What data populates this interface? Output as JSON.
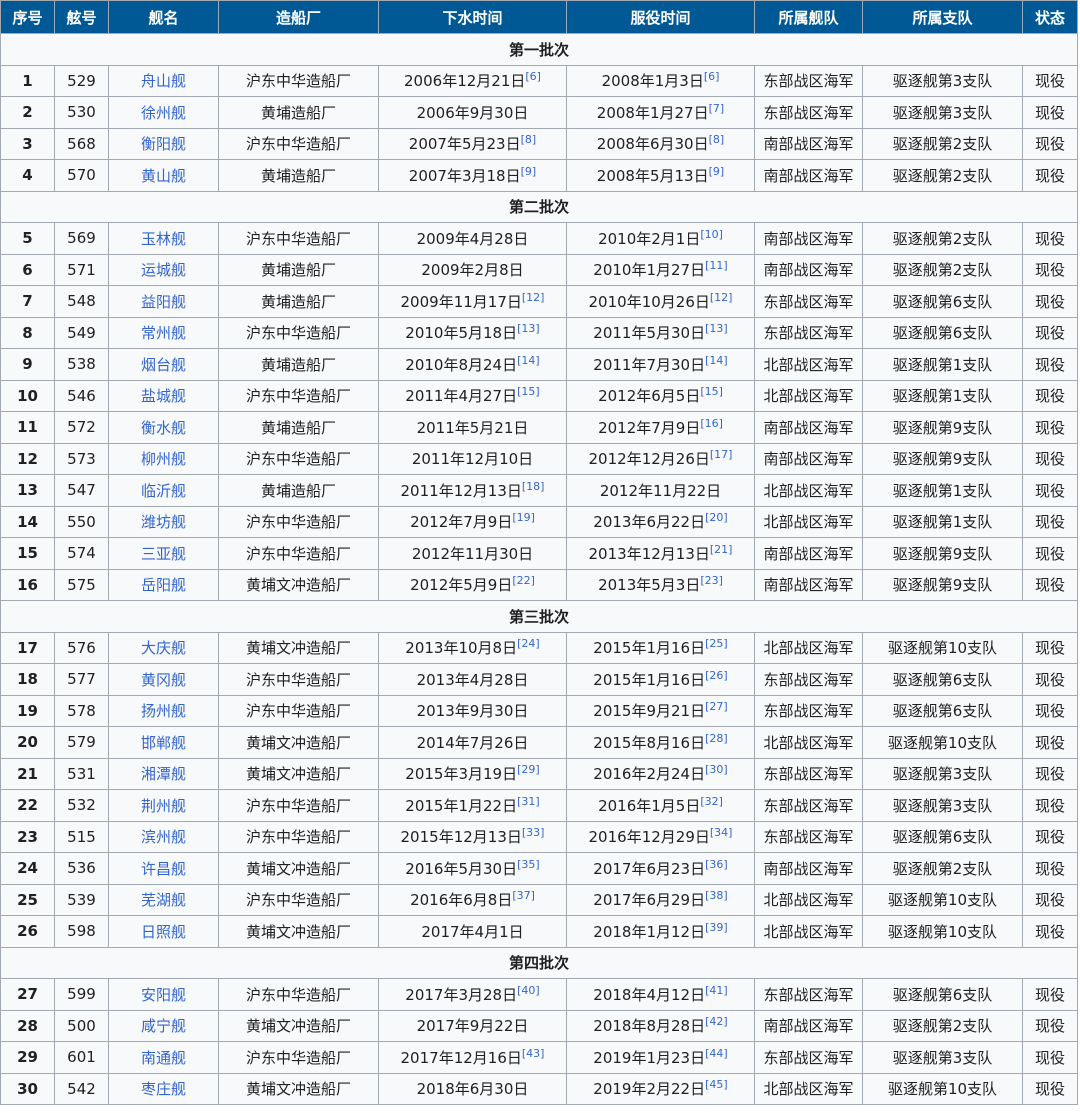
{
  "headers": [
    "序号",
    "舷号",
    "舰名",
    "造船厂",
    "下水时间",
    "服役时间",
    "所属舰队",
    "所属支队",
    "状态"
  ],
  "groups": [
    {
      "title": "第一批次",
      "rows": [
        {
          "no": "1",
          "hull": "529",
          "name": "舟山舰",
          "yard": "沪东中华造船厂",
          "launch": "2006年12月21日",
          "launch_ref": "[6]",
          "commission": "2008年1月3日",
          "commission_ref": "[6]",
          "fleet": "东部战区海军",
          "flotilla": "驱逐舰第3支队",
          "status": "现役"
        },
        {
          "no": "2",
          "hull": "530",
          "name": "徐州舰",
          "yard": "黄埔造船厂",
          "launch": "2006年9月30日",
          "launch_ref": "",
          "commission": "2008年1月27日",
          "commission_ref": "[7]",
          "fleet": "东部战区海军",
          "flotilla": "驱逐舰第3支队",
          "status": "现役"
        },
        {
          "no": "3",
          "hull": "568",
          "name": "衡阳舰",
          "yard": "沪东中华造船厂",
          "launch": "2007年5月23日",
          "launch_ref": "[8]",
          "commission": "2008年6月30日",
          "commission_ref": "[8]",
          "fleet": "南部战区海军",
          "flotilla": "驱逐舰第2支队",
          "status": "现役"
        },
        {
          "no": "4",
          "hull": "570",
          "name": "黄山舰",
          "yard": "黄埔造船厂",
          "launch": "2007年3月18日",
          "launch_ref": "[9]",
          "commission": "2008年5月13日",
          "commission_ref": "[9]",
          "fleet": "南部战区海军",
          "flotilla": "驱逐舰第2支队",
          "status": "现役"
        }
      ]
    },
    {
      "title": "第二批次",
      "rows": [
        {
          "no": "5",
          "hull": "569",
          "name": "玉林舰",
          "yard": "沪东中华造船厂",
          "launch": "2009年4月28日",
          "launch_ref": "",
          "commission": "2010年2月1日",
          "commission_ref": "[10]",
          "fleet": "南部战区海军",
          "flotilla": "驱逐舰第2支队",
          "status": "现役"
        },
        {
          "no": "6",
          "hull": "571",
          "name": "运城舰",
          "yard": "黄埔造船厂",
          "launch": "2009年2月8日",
          "launch_ref": "",
          "commission": "2010年1月27日",
          "commission_ref": "[11]",
          "fleet": "南部战区海军",
          "flotilla": "驱逐舰第2支队",
          "status": "现役"
        },
        {
          "no": "7",
          "hull": "548",
          "name": "益阳舰",
          "yard": "黄埔造船厂",
          "launch": "2009年11月17日",
          "launch_ref": "[12]",
          "commission": "2010年10月26日",
          "commission_ref": "[12]",
          "fleet": "东部战区海军",
          "flotilla": "驱逐舰第6支队",
          "status": "现役"
        },
        {
          "no": "8",
          "hull": "549",
          "name": "常州舰",
          "yard": "沪东中华造船厂",
          "launch": "2010年5月18日",
          "launch_ref": "[13]",
          "commission": "2011年5月30日",
          "commission_ref": "[13]",
          "fleet": "东部战区海军",
          "flotilla": "驱逐舰第6支队",
          "status": "现役"
        },
        {
          "no": "9",
          "hull": "538",
          "name": "烟台舰",
          "yard": "黄埔造船厂",
          "launch": "2010年8月24日",
          "launch_ref": "[14]",
          "commission": "2011年7月30日",
          "commission_ref": "[14]",
          "fleet": "北部战区海军",
          "flotilla": "驱逐舰第1支队",
          "status": "现役"
        },
        {
          "no": "10",
          "hull": "546",
          "name": "盐城舰",
          "yard": "沪东中华造船厂",
          "launch": "2011年4月27日",
          "launch_ref": "[15]",
          "commission": "2012年6月5日",
          "commission_ref": "[15]",
          "fleet": "北部战区海军",
          "flotilla": "驱逐舰第1支队",
          "status": "现役"
        },
        {
          "no": "11",
          "hull": "572",
          "name": "衡水舰",
          "yard": "黄埔造船厂",
          "launch": "2011年5月21日",
          "launch_ref": "",
          "commission": "2012年7月9日",
          "commission_ref": "[16]",
          "fleet": "南部战区海军",
          "flotilla": "驱逐舰第9支队",
          "status": "现役"
        },
        {
          "no": "12",
          "hull": "573",
          "name": "柳州舰",
          "yard": "沪东中华造船厂",
          "launch": "2011年12月10日",
          "launch_ref": "",
          "commission": "2012年12月26日",
          "commission_ref": "[17]",
          "fleet": "南部战区海军",
          "flotilla": "驱逐舰第9支队",
          "status": "现役"
        },
        {
          "no": "13",
          "hull": "547",
          "name": "临沂舰",
          "yard": "黄埔造船厂",
          "launch": "2011年12月13日",
          "launch_ref": "[18]",
          "commission": "2012年11月22日",
          "commission_ref": "",
          "fleet": "北部战区海军",
          "flotilla": "驱逐舰第1支队",
          "status": "现役"
        },
        {
          "no": "14",
          "hull": "550",
          "name": "潍坊舰",
          "yard": "沪东中华造船厂",
          "launch": "2012年7月9日",
          "launch_ref": "[19]",
          "commission": "2013年6月22日",
          "commission_ref": "[20]",
          "fleet": "北部战区海军",
          "flotilla": "驱逐舰第1支队",
          "status": "现役"
        },
        {
          "no": "15",
          "hull": "574",
          "name": "三亚舰",
          "yard": "沪东中华造船厂",
          "launch": "2012年11月30日",
          "launch_ref": "",
          "commission": "2013年12月13日",
          "commission_ref": "[21]",
          "fleet": "南部战区海军",
          "flotilla": "驱逐舰第9支队",
          "status": "现役"
        },
        {
          "no": "16",
          "hull": "575",
          "name": "岳阳舰",
          "yard": "黄埔文冲造船厂",
          "launch": "2012年5月9日",
          "launch_ref": "[22]",
          "commission": "2013年5月3日",
          "commission_ref": "[23]",
          "fleet": "南部战区海军",
          "flotilla": "驱逐舰第9支队",
          "status": "现役"
        }
      ]
    },
    {
      "title": "第三批次",
      "rows": [
        {
          "no": "17",
          "hull": "576",
          "name": "大庆舰",
          "yard": "黄埔文冲造船厂",
          "launch": "2013年10月8日",
          "launch_ref": "[24]",
          "commission": "2015年1月16日",
          "commission_ref": "[25]",
          "fleet": "北部战区海军",
          "flotilla": "驱逐舰第10支队",
          "status": "现役"
        },
        {
          "no": "18",
          "hull": "577",
          "name": "黄冈舰",
          "yard": "沪东中华造船厂",
          "launch": "2013年4月28日",
          "launch_ref": "",
          "commission": "2015年1月16日",
          "commission_ref": "[26]",
          "fleet": "东部战区海军",
          "flotilla": "驱逐舰第6支队",
          "status": "现役"
        },
        {
          "no": "19",
          "hull": "578",
          "name": "扬州舰",
          "yard": "沪东中华造船厂",
          "launch": "2013年9月30日",
          "launch_ref": "",
          "commission": "2015年9月21日",
          "commission_ref": "[27]",
          "fleet": "东部战区海军",
          "flotilla": "驱逐舰第6支队",
          "status": "现役"
        },
        {
          "no": "20",
          "hull": "579",
          "name": "邯郸舰",
          "yard": "黄埔文冲造船厂",
          "launch": "2014年7月26日",
          "launch_ref": "",
          "commission": "2015年8月16日",
          "commission_ref": "[28]",
          "fleet": "北部战区海军",
          "flotilla": "驱逐舰第10支队",
          "status": "现役"
        },
        {
          "no": "21",
          "hull": "531",
          "name": "湘潭舰",
          "yard": "黄埔文冲造船厂",
          "launch": "2015年3月19日",
          "launch_ref": "[29]",
          "commission": "2016年2月24日",
          "commission_ref": "[30]",
          "fleet": "东部战区海军",
          "flotilla": "驱逐舰第3支队",
          "status": "现役"
        },
        {
          "no": "22",
          "hull": "532",
          "name": "荆州舰",
          "yard": "沪东中华造船厂",
          "launch": "2015年1月22日",
          "launch_ref": "[31]",
          "commission": "2016年1月5日",
          "commission_ref": "[32]",
          "fleet": "东部战区海军",
          "flotilla": "驱逐舰第3支队",
          "status": "现役"
        },
        {
          "no": "23",
          "hull": "515",
          "name": "滨州舰",
          "yard": "沪东中华造船厂",
          "launch": "2015年12月13日",
          "launch_ref": "[33]",
          "commission": "2016年12月29日",
          "commission_ref": "[34]",
          "fleet": "东部战区海军",
          "flotilla": "驱逐舰第6支队",
          "status": "现役"
        },
        {
          "no": "24",
          "hull": "536",
          "name": "许昌舰",
          "yard": "黄埔文冲造船厂",
          "launch": "2016年5月30日",
          "launch_ref": "[35]",
          "commission": "2017年6月23日",
          "commission_ref": "[36]",
          "fleet": "南部战区海军",
          "flotilla": "驱逐舰第2支队",
          "status": "现役"
        },
        {
          "no": "25",
          "hull": "539",
          "name": "芜湖舰",
          "yard": "沪东中华造船厂",
          "launch": "2016年6月8日",
          "launch_ref": "[37]",
          "commission": "2017年6月29日",
          "commission_ref": "[38]",
          "fleet": "北部战区海军",
          "flotilla": "驱逐舰第10支队",
          "status": "现役"
        },
        {
          "no": "26",
          "hull": "598",
          "name": "日照舰",
          "yard": "黄埔文冲造船厂",
          "launch": "2017年4月1日",
          "launch_ref": "",
          "commission": "2018年1月12日",
          "commission_ref": "[39]",
          "fleet": "北部战区海军",
          "flotilla": "驱逐舰第10支队",
          "status": "现役"
        }
      ]
    },
    {
      "title": "第四批次",
      "rows": [
        {
          "no": "27",
          "hull": "599",
          "name": "安阳舰",
          "yard": "沪东中华造船厂",
          "launch": "2017年3月28日",
          "launch_ref": "[40]",
          "commission": "2018年4月12日",
          "commission_ref": "[41]",
          "fleet": "东部战区海军",
          "flotilla": "驱逐舰第6支队",
          "status": "现役"
        },
        {
          "no": "28",
          "hull": "500",
          "name": "咸宁舰",
          "yard": "黄埔文冲造船厂",
          "launch": "2017年9月22日",
          "launch_ref": "",
          "commission": "2018年8月28日",
          "commission_ref": "[42]",
          "fleet": "南部战区海军",
          "flotilla": "驱逐舰第2支队",
          "status": "现役"
        },
        {
          "no": "29",
          "hull": "601",
          "name": "南通舰",
          "yard": "沪东中华造船厂",
          "launch": "2017年12月16日",
          "launch_ref": "[43]",
          "commission": "2019年1月23日",
          "commission_ref": "[44]",
          "fleet": "东部战区海军",
          "flotilla": "驱逐舰第3支队",
          "status": "现役"
        },
        {
          "no": "30",
          "hull": "542",
          "name": "枣庄舰",
          "yard": "黄埔文冲造船厂",
          "launch": "2018年6月30日",
          "launch_ref": "",
          "commission": "2019年2月22日",
          "commission_ref": "[45]",
          "fleet": "北部战区海军",
          "flotilla": "驱逐舰第10支队",
          "status": "现役"
        }
      ]
    }
  ]
}
